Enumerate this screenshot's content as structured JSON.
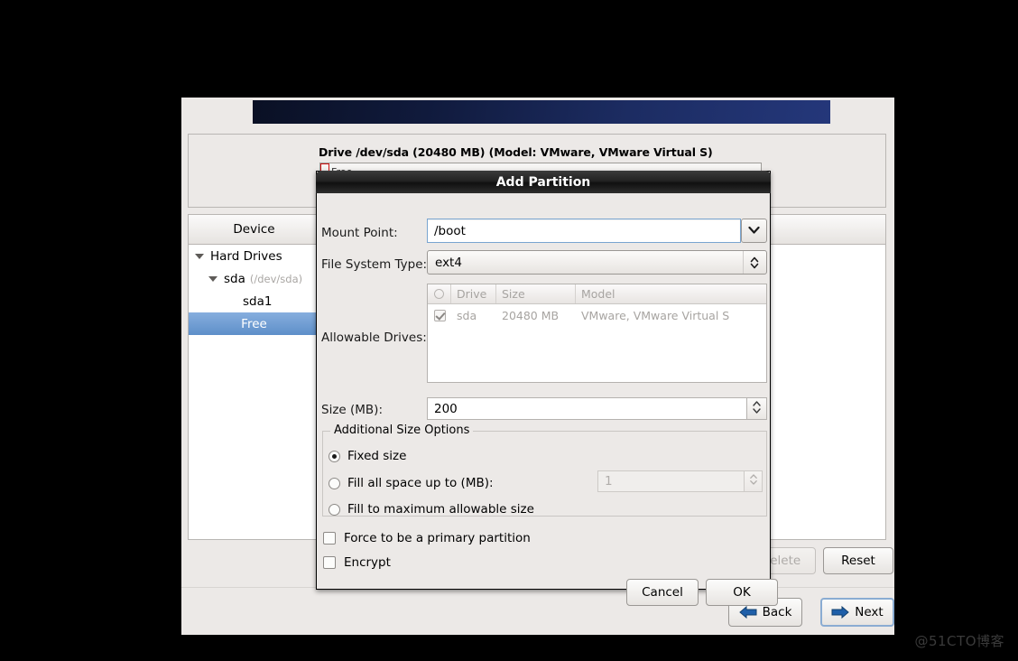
{
  "screen": {
    "background_color": "#000000",
    "watermark": "@51CTO博客"
  },
  "installer": {
    "drive_panel": {
      "drive_title": "Drive /dev/sda (20480 MB) (Model: VMware, VMware Virtual S)",
      "segments": [
        {
          "label": "Free",
          "border_color": "#cc1111"
        }
      ]
    },
    "tree": {
      "columns": [
        "Device"
      ],
      "rows": [
        {
          "label": "Hard Drives",
          "sub": "",
          "depth": 0,
          "expander": "triangle-down-icon",
          "selected": false
        },
        {
          "label": "sda",
          "sub": "(/dev/sda)",
          "depth": 1,
          "expander": "triangle-down-icon",
          "selected": false
        },
        {
          "label": "sda1",
          "sub": "",
          "depth": 2,
          "expander": "",
          "selected": false
        },
        {
          "label": "Free",
          "sub": "",
          "depth": 2,
          "expander": "",
          "selected": true
        }
      ],
      "selected_color": "#5e8fc9"
    },
    "actions": {
      "delete_label": "Delete",
      "delete_enabled": false,
      "reset_label": "Reset",
      "reset_enabled": true
    },
    "navigation": {
      "back_label": "Back",
      "next_label": "Next",
      "arrow_color": "#1f5fa9"
    }
  },
  "dialog": {
    "title": "Add Partition",
    "mount_point": {
      "label": "Mount Point:",
      "value": "/boot",
      "placeholder": "",
      "dropdown_icon": "chevron-down-icon"
    },
    "file_system_type": {
      "label": "File System Type:",
      "value": "ext4",
      "arrow_icon": "chevron-up-down-icon"
    },
    "allowable_drives": {
      "label": "Allowable Drives:",
      "columns": [
        "",
        "Drive",
        "Size",
        "Model"
      ],
      "rows": [
        {
          "checked": true,
          "drive": "sda",
          "size": "20480 MB",
          "model": "VMware, VMware Virtual S"
        }
      ],
      "disabled_text_color": "#a7a4a1"
    },
    "size": {
      "label": "Size (MB):",
      "value": "200",
      "spinner_icon": "spinner-up-down-icon"
    },
    "additional_size_options": {
      "legend": "Additional Size Options",
      "options": [
        {
          "label": "Fixed size",
          "selected": true
        },
        {
          "label": "Fill all space up to (MB):",
          "selected": false
        },
        {
          "label": "Fill to maximum allowable size",
          "selected": false
        }
      ],
      "fill_up_to_value": "1",
      "fill_up_to_enabled": false
    },
    "checkboxes": [
      {
        "label": "Force to be a primary partition",
        "checked": false
      },
      {
        "label": "Encrypt",
        "checked": false
      }
    ],
    "buttons": {
      "cancel_label": "Cancel",
      "ok_label": "OK"
    }
  }
}
